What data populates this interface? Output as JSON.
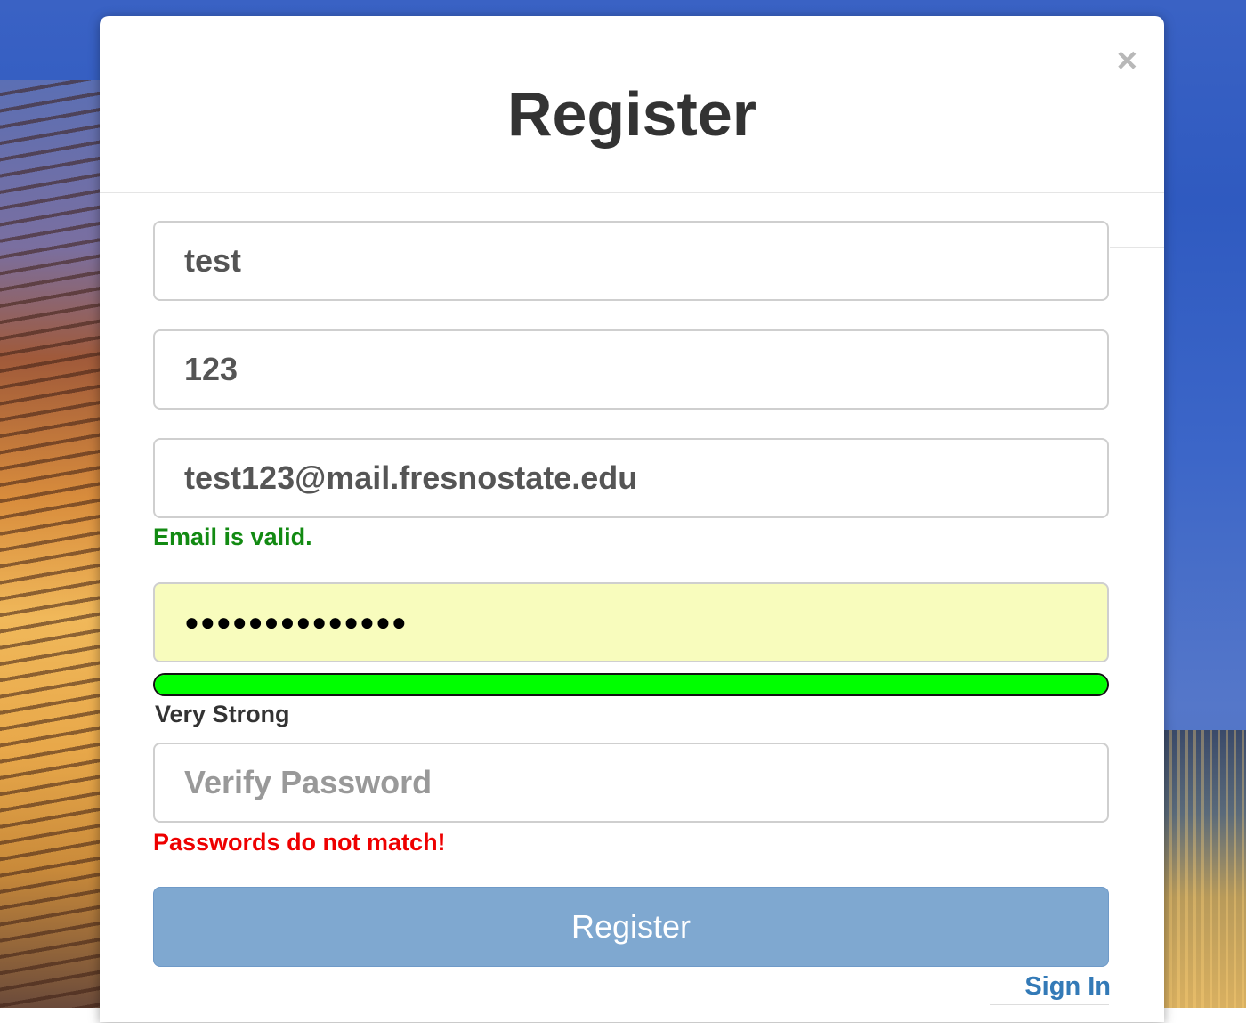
{
  "modal": {
    "title": "Register",
    "close_glyph": "×"
  },
  "form": {
    "first_field": {
      "value": "test"
    },
    "second_field": {
      "value": "123"
    },
    "email_field": {
      "value": "test123@mail.fresnostate.edu"
    },
    "email_status": "Email is valid.",
    "password_field": {
      "masked_value": "●●●●●●●●●●●●●●"
    },
    "password_strength": {
      "label": "Very Strong",
      "fraction": 1.0,
      "color": "#00ff00"
    },
    "verify_password_field": {
      "value": "",
      "placeholder": "Verify Password"
    },
    "verify_status": "Passwords do not match!",
    "submit_label": "Register",
    "sign_in_label": "Sign In"
  },
  "colors": {
    "valid": "#128a12",
    "error": "#ee0000",
    "button": "#7fa8d0",
    "link": "#337ab7",
    "autofill": "#f8fcbd"
  },
  "icons": {
    "close": "close-icon"
  }
}
